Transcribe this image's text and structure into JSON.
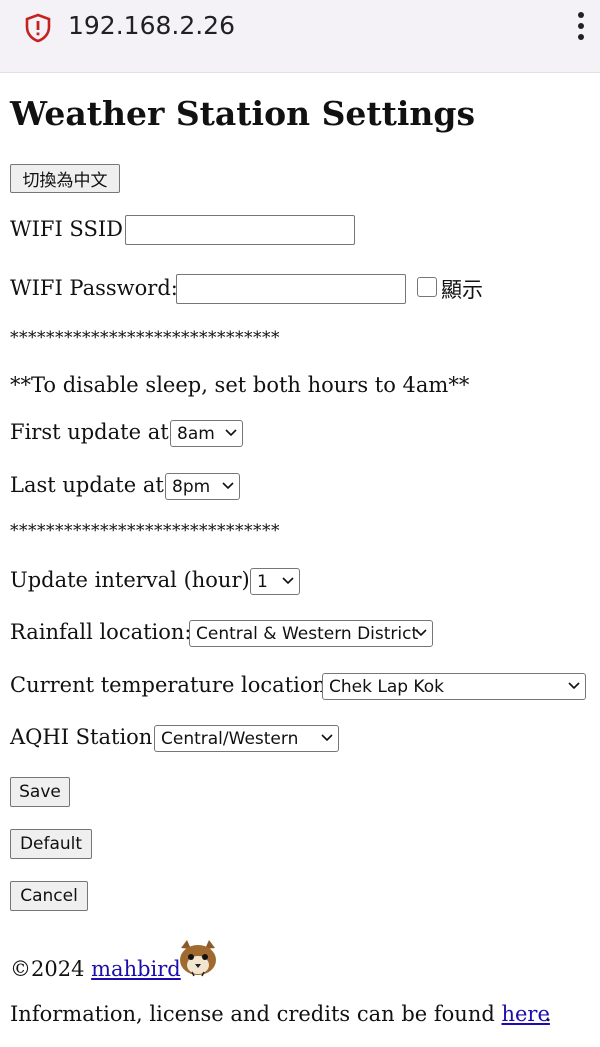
{
  "browser": {
    "url": "192.168.2.26"
  },
  "page": {
    "title": "Weather Station Settings",
    "language_button": "切換為中文",
    "wifi_ssid_label": "WIFI SSID:",
    "wifi_ssid_value": "",
    "wifi_password_label": "WIFI Password:",
    "wifi_password_value": "",
    "show_password_label": "顯示",
    "separator": "******************************",
    "sleep_note": "**To disable sleep, set both hours to 4am**",
    "first_update_label": "First update at:",
    "first_update_value": "8am",
    "last_update_label": "Last update at:",
    "last_update_value": "8pm",
    "interval_label": "Update interval (hour):",
    "interval_value": "1",
    "rainfall_label": "Rainfall location:",
    "rainfall_value": "Central & Western District",
    "temperature_label": "Current temperature location:",
    "temperature_value": "Chek Lap Kok",
    "aqhi_label": "AQHI Station:",
    "aqhi_value": "Central/Western",
    "save_button": "Save",
    "default_button": "Default",
    "cancel_button": "Cancel",
    "copyright": "©2024",
    "author_link": "mahbird",
    "info_prefix": "Information, license and credits can be found",
    "info_link": "here",
    "info_suffix": "."
  }
}
